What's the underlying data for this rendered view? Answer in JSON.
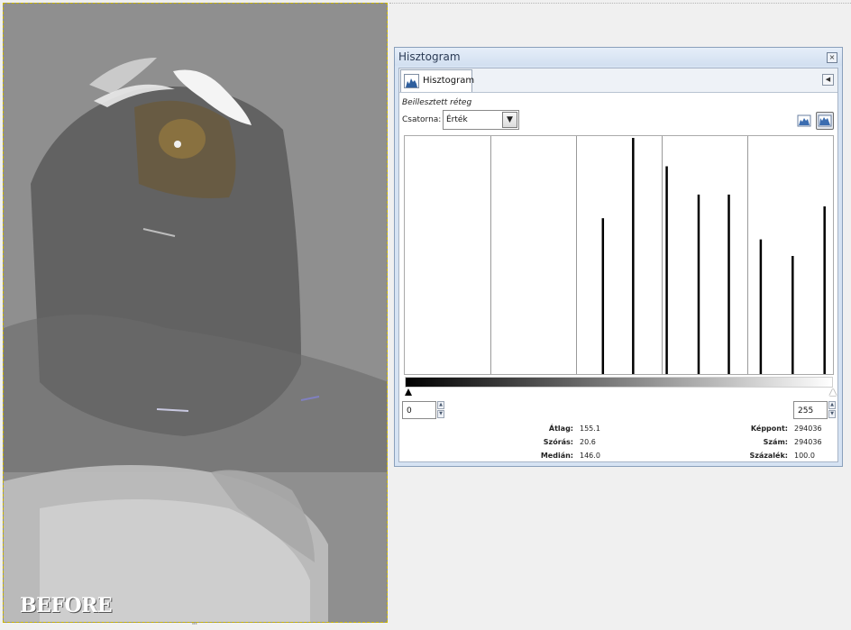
{
  "canvas": {
    "label": "BEFORE"
  },
  "histogram_window": {
    "title": "Hisztogram",
    "tab_label": "Hisztogram",
    "layer_name": "Beillesztett réteg",
    "channel": {
      "label": "Csatorna:",
      "value": "Érték"
    },
    "range": {
      "low": "0",
      "high": "255"
    },
    "stats": {
      "mean_label": "Átlag:",
      "mean_value": "155.1",
      "std_label": "Szórás:",
      "std_value": "20.6",
      "median_label": "Medián:",
      "median_value": "146.0",
      "pixels_label": "Képpont:",
      "pixels_value": "294036",
      "count_label": "Szám:",
      "count_value": "294036",
      "percent_label": "Százalék:",
      "percent_value": "100.0"
    }
  },
  "chart_data": {
    "type": "bar",
    "x": [
      118,
      136,
      156,
      175,
      193,
      212,
      231,
      250
    ],
    "values": [
      0.66,
      1.0,
      0.88,
      0.76,
      0.76,
      0.57,
      0.5,
      0.71
    ],
    "xlim": [
      0,
      255
    ],
    "ylim": [
      0,
      1
    ],
    "grid": true
  }
}
